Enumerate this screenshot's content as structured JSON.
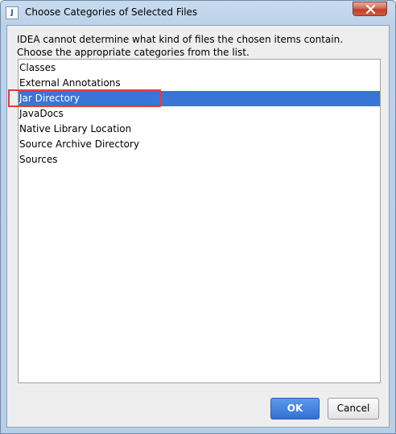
{
  "window": {
    "title": "Choose Categories of Selected Files",
    "app_icon_glyph": "J",
    "close_icon": "close-icon"
  },
  "message": {
    "line1": "IDEA cannot determine what kind of files the chosen items contain.",
    "line2": "Choose the appropriate categories from the list."
  },
  "categories": {
    "items": [
      {
        "label": "Classes"
      },
      {
        "label": "External Annotations"
      },
      {
        "label": "Jar Directory"
      },
      {
        "label": "JavaDocs"
      },
      {
        "label": "Native Library Location"
      },
      {
        "label": "Source Archive Directory"
      },
      {
        "label": "Sources"
      }
    ],
    "selected": "Jar Directory"
  },
  "buttons": {
    "ok_label": "OK",
    "cancel_label": "Cancel"
  },
  "colors": {
    "selection": "#3875d7",
    "annotation_box": "#e23e3e",
    "ok_button": "#3470d5"
  }
}
